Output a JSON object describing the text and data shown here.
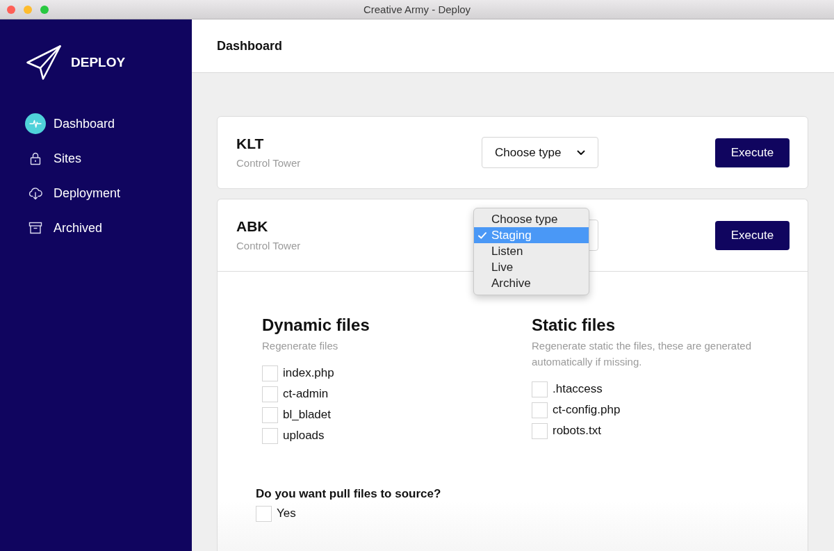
{
  "window": {
    "title": "Creative Army - Deploy"
  },
  "sidebar": {
    "logo": "DEPLOY",
    "items": [
      {
        "label": "Dashboard",
        "selected": true
      },
      {
        "label": "Sites",
        "selected": false
      },
      {
        "label": "Deployment",
        "selected": false
      },
      {
        "label": "Archived",
        "selected": false
      }
    ]
  },
  "header": {
    "title": "Dashboard"
  },
  "sites": [
    {
      "name": "KLT",
      "subtitle": "Control Tower",
      "select": {
        "value": "Choose type",
        "open": false
      },
      "button": "Execute",
      "expanded": false
    },
    {
      "name": "ABK",
      "subtitle": "Control Tower",
      "select": {
        "open": true,
        "options": [
          {
            "label": "Choose type",
            "selected": false
          },
          {
            "label": "Staging",
            "selected": true
          },
          {
            "label": "Listen",
            "selected": false
          },
          {
            "label": "Live",
            "selected": false
          },
          {
            "label": "Archive",
            "selected": false
          }
        ]
      },
      "button": "Execute",
      "expanded": true,
      "details": {
        "sections": [
          {
            "title": "Dynamic files",
            "description": "Regenerate files",
            "files": [
              {
                "label": "index.php",
                "checked": false
              },
              {
                "label": "ct-admin",
                "checked": false
              },
              {
                "label": "bl_bladet",
                "checked": false
              },
              {
                "label": "uploads",
                "checked": false
              }
            ]
          },
          {
            "title": "Static files",
            "description": "Regenerate static the files, these are generated automatically if missing.",
            "files": [
              {
                "label": ".htaccess",
                "checked": false
              },
              {
                "label": "ct-config.php",
                "checked": false
              },
              {
                "label": "robots.txt",
                "checked": false
              }
            ]
          }
        ],
        "question": {
          "text": "Do you want pull files to source?",
          "options": [
            {
              "label": "Yes",
              "checked": false
            }
          ]
        }
      }
    }
  ]
}
